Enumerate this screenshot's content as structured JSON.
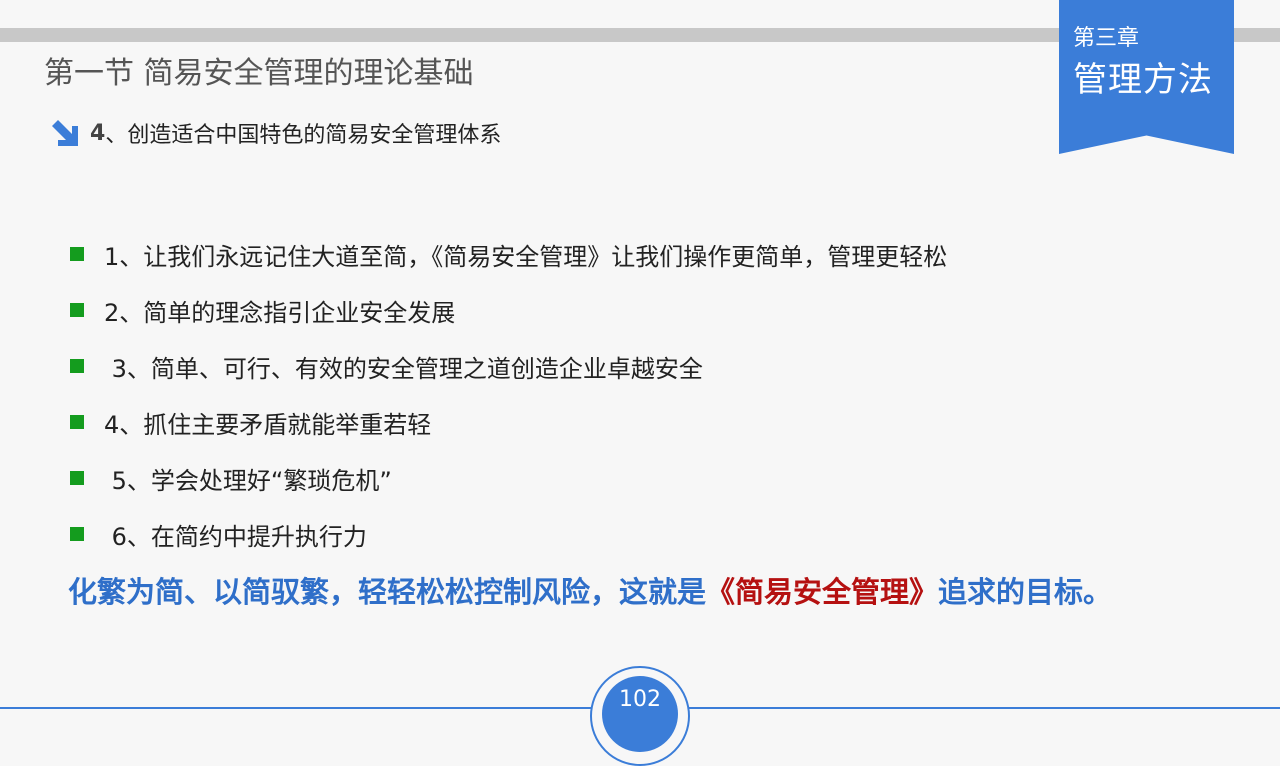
{
  "chapter": {
    "number": "第三章",
    "title": "管理方法"
  },
  "section": {
    "title": "第一节  简易安全管理的理论基础"
  },
  "subtitle": {
    "number": "4",
    "text": "、创造适合中国特色的简易安全管理体系",
    "icon": "arrow-down-right-icon"
  },
  "bullets": [
    "1、让我们永远记住大道至简，《简易安全管理》让我们操作更简单，管理更轻松",
    "2、简单的理念指引企业安全发展",
    " 3、简单、可行、有效的安全管理之道创造企业卓越安全",
    "4、抓住主要矛盾就能举重若轻",
    " 5、学会处理好“繁琐危机”",
    " 6、在简约中提升执行力"
  ],
  "conclusion": {
    "before": "化繁为简、以简驭繁，轻轻松松控制风险，这就是",
    "highlight": "《简易安全管理》",
    "after": "追求的目标。"
  },
  "page": {
    "number": "102"
  },
  "colors": {
    "accent": "#3b7dd8",
    "bullet": "#149c1e",
    "highlight": "#b51111",
    "conclusion": "#2f6fc9"
  }
}
